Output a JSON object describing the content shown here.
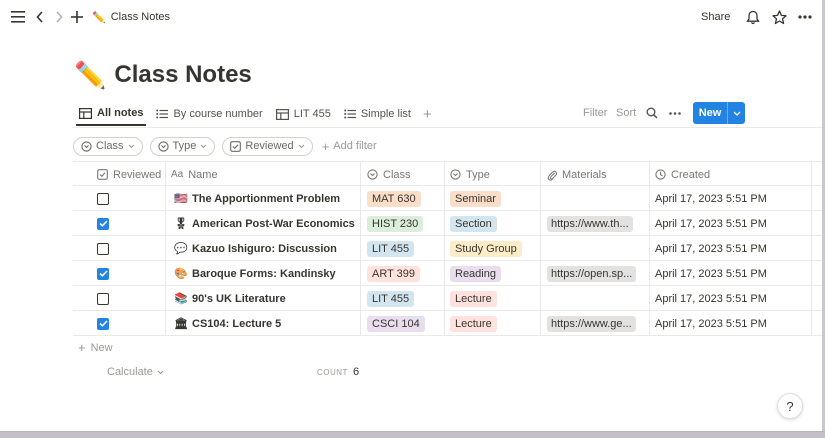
{
  "topbar": {
    "page_emoji": "✏️",
    "page_title": "Class Notes",
    "share_label": "Share"
  },
  "page": {
    "emoji": "✏️",
    "title": "Class Notes"
  },
  "views": {
    "tabs": [
      {
        "label": "All notes",
        "icon": "table-icon",
        "active": true
      },
      {
        "label": "By course number",
        "icon": "list-icon",
        "active": false
      },
      {
        "label": "LIT 455",
        "icon": "table-icon",
        "active": false
      },
      {
        "label": "Simple list",
        "icon": "list-icon",
        "active": false
      }
    ],
    "filter_label": "Filter",
    "sort_label": "Sort",
    "new_label": "New"
  },
  "filters": {
    "chips": [
      {
        "label": "Class",
        "icon": "circle-chevron-icon"
      },
      {
        "label": "Type",
        "icon": "circle-chevron-icon"
      },
      {
        "label": "Reviewed",
        "icon": "checkbox-icon"
      }
    ],
    "add_filter_label": "Add filter"
  },
  "table": {
    "columns": {
      "reviewed": "Reviewed",
      "name": "Name",
      "name_icon_text": "Aa",
      "class": "Class",
      "type": "Type",
      "materials": "Materials",
      "created": "Created"
    },
    "rows": [
      {
        "reviewed": false,
        "icon": "🇺🇸",
        "name": "The Apportionment Problem",
        "class": "MAT 630",
        "class_color": "#fadec9",
        "type": "Seminar",
        "type_color": "#fadec9",
        "materials": "",
        "created": "April 17, 2023 5:51 PM"
      },
      {
        "reviewed": true,
        "icon": "🎖",
        "name": "American Post-War Economics",
        "class": "HIST 230",
        "class_color": "#dbeddb",
        "type": "Section",
        "type_color": "#d3e5ef",
        "materials": "https://www.th...",
        "created": "April 17, 2023 5:51 PM"
      },
      {
        "reviewed": false,
        "icon": "💬",
        "name": "Kazuo Ishiguro: Discussion",
        "class": "LIT 455",
        "class_color": "#d3e5ef",
        "type": "Study Group",
        "type_color": "#fdecc8",
        "materials": "",
        "created": "April 17, 2023 5:51 PM"
      },
      {
        "reviewed": true,
        "icon": "🎨",
        "name": "Baroque Forms: Kandinsky",
        "class": "ART 399",
        "class_color": "#ffe2dd",
        "type": "Reading",
        "type_color": "#e8deee",
        "materials": "https://open.sp...",
        "created": "April 17, 2023 5:51 PM"
      },
      {
        "reviewed": false,
        "icon": "📚",
        "name": "90's UK Literature",
        "class": "LIT 455",
        "class_color": "#d3e5ef",
        "type": "Lecture",
        "type_color": "#ffe2dd",
        "materials": "",
        "created": "April 17, 2023 5:51 PM"
      },
      {
        "reviewed": true,
        "icon": "🏛",
        "name": "CS104: Lecture 5",
        "class": "CSCI 104",
        "class_color": "#e8deee",
        "type": "Lecture",
        "type_color": "#ffe2dd",
        "materials": "https://www.ge...",
        "created": "April 17, 2023 5:51 PM"
      }
    ],
    "new_row_label": "New",
    "calculate_label": "Calculate",
    "count_label": "COUNT",
    "count_value": "6"
  },
  "help_label": "?"
}
